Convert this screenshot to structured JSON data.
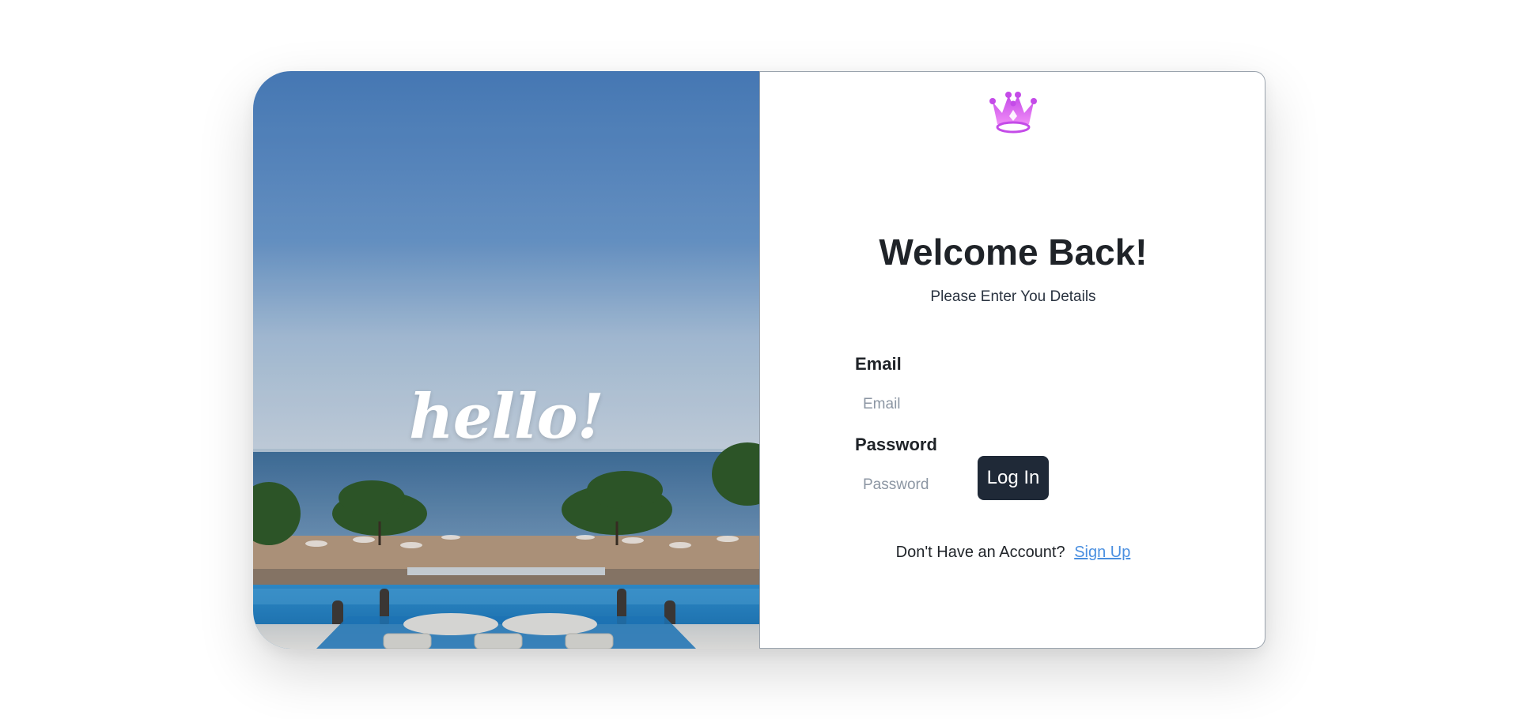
{
  "hero": {
    "overlay_text": "hello!"
  },
  "login": {
    "logo_icon": "crown-icon",
    "title": "Welcome Back!",
    "subtitle": "Please Enter You Details",
    "email_label": "Email",
    "email_placeholder": "Email",
    "email_value": "",
    "password_label": "Password",
    "password_placeholder": "Password",
    "password_value": "",
    "login_button": "Log In",
    "signup_prompt": "Don't Have an Account?",
    "signup_link": "Sign Up"
  },
  "colors": {
    "button_bg": "#1f2937",
    "link": "#4a8fe0",
    "crown_gradient_top": "#c44be8",
    "crown_gradient_bottom": "#f08cf7"
  }
}
